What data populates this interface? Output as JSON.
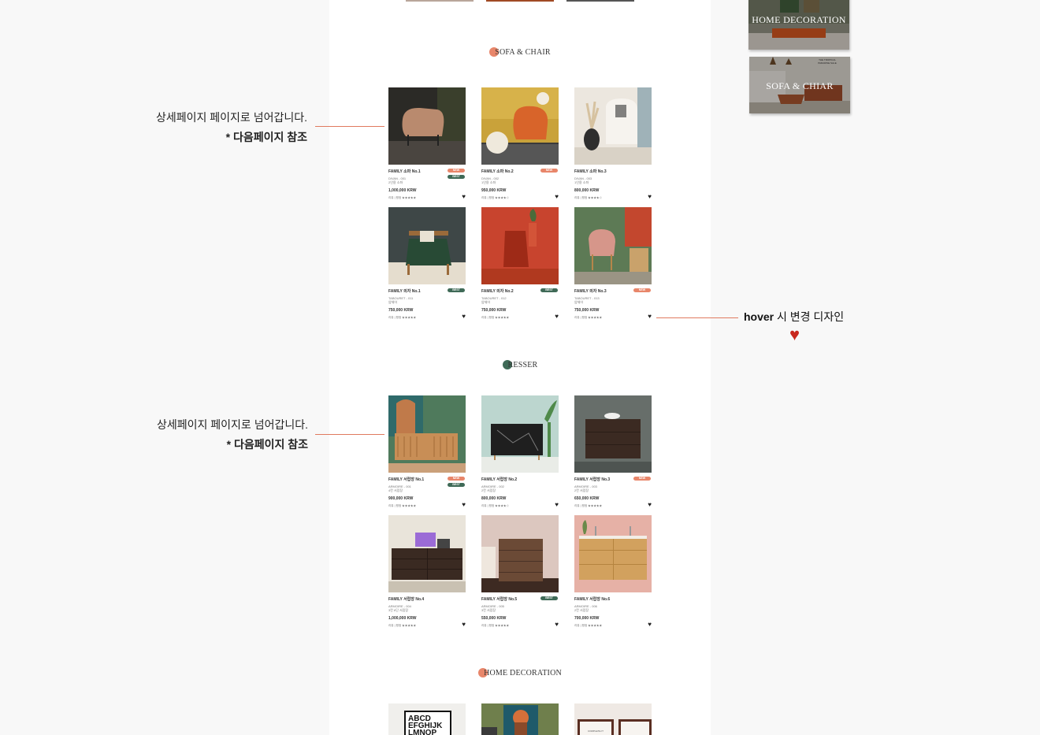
{
  "colors": {
    "accent_orange": "#e8866a",
    "accent_green": "#3f6a57",
    "badge_new": "#e8866a",
    "badge_best": "#3f6a57",
    "hover_heart": "#c8281e",
    "annotation_line": "#e07a5f"
  },
  "sections": {
    "sofa_chair": {
      "title": "SOFA & CHAIR"
    },
    "dresser": {
      "title": "RESSER"
    },
    "home_decoration": {
      "title": "HOME DECORATION"
    }
  },
  "products": {
    "sofa": [
      {
        "name": "FAMILY 소파 No.1",
        "code": "DIVAN - 001",
        "sub": "2인용 소파",
        "price": "1,000,000 KRW",
        "meta": "리뷰  |  평점 ★★★★★",
        "badges": [
          "NEW",
          "BEST"
        ]
      },
      {
        "name": "FAMILY 소파 No.2",
        "code": "DIVAN - 002",
        "sub": "1인용 소파",
        "price": "950,000 KRW",
        "meta": "리뷰  |  평점 ★★★★☆",
        "badges": [
          "NEW"
        ]
      },
      {
        "name": "FAMILY 소파 No.3",
        "code": "DIVAN - 003",
        "sub": "1인용 소파",
        "price": "800,000 KRW",
        "meta": "리뷰  |  평점 ★★★★☆",
        "badges": []
      },
      {
        "name": "FAMILY 의자 No.1",
        "code": "TABOURET - 011",
        "sub": "암체어",
        "price": "750,000 KRW",
        "meta": "리뷰  |  평점 ★★★★★",
        "badges": [
          "BEST"
        ]
      },
      {
        "name": "FAMILY 의자 No.2",
        "code": "TABOURET - 012",
        "sub": "암체어",
        "price": "750,000 KRW",
        "meta": "리뷰  |  평점 ★★★★★",
        "badges": [
          "BEST"
        ]
      },
      {
        "name": "FAMILY 의자 No.3",
        "code": "TABOURET - 013",
        "sub": "암체어",
        "price": "750,000 KRW",
        "meta": "리뷰  |  평점 ★★★★★",
        "badges": [
          "NEW"
        ]
      }
    ],
    "dresser": [
      {
        "name": "FAMILY 서랍장 No.1",
        "code": "ARMOIRE - 001",
        "sub": "4칸 서랍장",
        "price": "900,000 KRW",
        "meta": "리뷰  |  평점 ★★★★★",
        "badges": [
          "NEW",
          "BEST"
        ]
      },
      {
        "name": "FAMILY 서랍장 No.2",
        "code": "ARMOIRE - 002",
        "sub": "2칸 서랍장",
        "price": "800,000 KRW",
        "meta": "리뷰  |  평점 ★★★★☆",
        "badges": []
      },
      {
        "name": "FAMILY 서랍장 No.3",
        "code": "ARMOIRE - 003",
        "sub": "2칸 서랍장",
        "price": "650,000 KRW",
        "meta": "리뷰  |  평점 ★★★★★",
        "badges": [
          "NEW"
        ]
      },
      {
        "name": "FAMILY 서랍장 No.4",
        "code": "ARMOIRE - 004",
        "sub": "3칸 6단 서랍장",
        "price": "1,000,000 KRW",
        "meta": "리뷰  |  평점 ★★★★★",
        "badges": []
      },
      {
        "name": "FAMILY 서랍장 No.5",
        "code": "ARMOIRE - 005",
        "sub": "3칸 서랍장",
        "price": "550,000 KRW",
        "meta": "리뷰  |  평점 ★★★★★",
        "badges": [
          "BEST"
        ]
      },
      {
        "name": "FAMILY 서랍장 No.6",
        "code": "ARMOIRE - 006",
        "sub": "2칸 서랍장",
        "price": "700,000 KRW",
        "meta": "리뷰  |  평점 ★★★★★",
        "badges": []
      }
    ],
    "decor_thumb_texts": {
      "poster_letters": "ABCD EFGHIJK LMNOP",
      "frame_caption": "COMPLETE IT"
    }
  },
  "annotations": {
    "detail_note_1": {
      "line1": "상세페이지 페이지로 넘어갑니다.",
      "line2": "* 다음페이지 참조"
    },
    "detail_note_2": {
      "line1": "상세페이지 페이지로 넘어갑니다.",
      "line2": "* 다음페이지 참조"
    },
    "hover_note": {
      "bold": "hover",
      "rest": " 시 변경 디자인"
    }
  },
  "side_thumbnails": [
    {
      "label": "HOME DECORATION"
    },
    {
      "label": "SOFA & CHIAR",
      "sign": "THE TROPICAL PARADISE SALE"
    }
  ],
  "icons": {
    "heart": "♥"
  }
}
